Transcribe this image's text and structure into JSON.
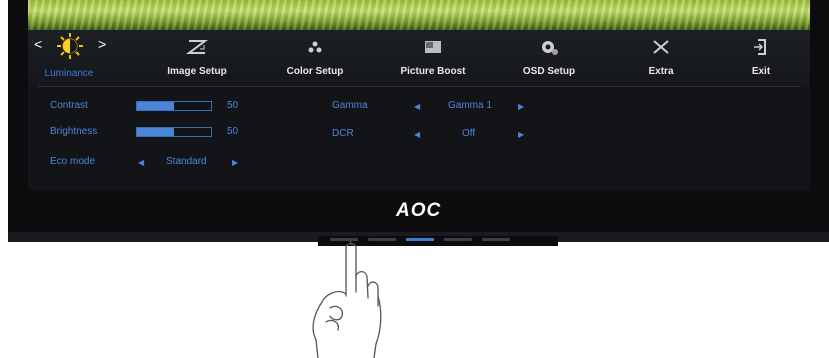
{
  "brand": "AOC",
  "menu": [
    {
      "label": "Luminance",
      "icon": "sun-icon",
      "active": true
    },
    {
      "label": "Image Setup",
      "icon": "image-setup-icon"
    },
    {
      "label": "Color Setup",
      "icon": "color-setup-icon"
    },
    {
      "label": "Picture Boost",
      "icon": "picture-boost-icon"
    },
    {
      "label": "OSD Setup",
      "icon": "osd-setup-icon"
    },
    {
      "label": "Extra",
      "icon": "tools-icon"
    },
    {
      "label": "Exit",
      "icon": "exit-icon"
    }
  ],
  "nav": {
    "left": "<",
    "right": ">"
  },
  "settings": {
    "contrast": {
      "label": "Contrast",
      "value": "50",
      "level": 0.5
    },
    "brightness": {
      "label": "Brightness",
      "value": "50",
      "level": 0.5
    },
    "eco_mode": {
      "label": "Eco mode",
      "value": "Standard"
    },
    "gamma": {
      "label": "Gamma",
      "value": "Gamma 1"
    },
    "dcr": {
      "label": "DCR",
      "value": "Off"
    }
  },
  "colors": {
    "accent": "#4a86d8",
    "active_tab": "#3c7cd8"
  }
}
